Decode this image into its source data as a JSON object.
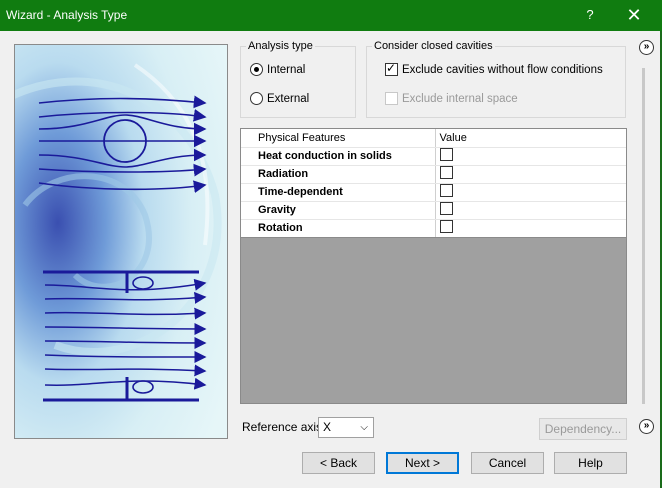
{
  "window": {
    "title": "Wizard - Analysis Type",
    "help_label": "?",
    "close_label": "✕"
  },
  "analysis_type": {
    "label": "Analysis type",
    "options": [
      {
        "label": "Internal",
        "selected": true
      },
      {
        "label": "External",
        "selected": false
      }
    ]
  },
  "cavities": {
    "label": "Consider closed cavities",
    "exclude_no_flow": {
      "label": "Exclude cavities without flow conditions",
      "checked": true
    },
    "exclude_internal": {
      "label": "Exclude internal space",
      "checked": false,
      "enabled": false
    }
  },
  "features_table": {
    "headers": [
      "Physical Features",
      "Value"
    ],
    "rows": [
      {
        "label": "Heat conduction in solids",
        "checked": false
      },
      {
        "label": "Radiation",
        "checked": false
      },
      {
        "label": "Time-dependent",
        "checked": false
      },
      {
        "label": "Gravity",
        "checked": false
      },
      {
        "label": "Rotation",
        "checked": false
      }
    ]
  },
  "reference_axis": {
    "label": "Reference axis:",
    "value": "X"
  },
  "buttons": {
    "dependency": "Dependency...",
    "back": "< Back",
    "next": "Next >",
    "cancel": "Cancel",
    "help": "Help"
  },
  "expand_icon": "»",
  "colors": {
    "titlebar": "#107c10",
    "flow_lines": "#1a1a9a"
  }
}
